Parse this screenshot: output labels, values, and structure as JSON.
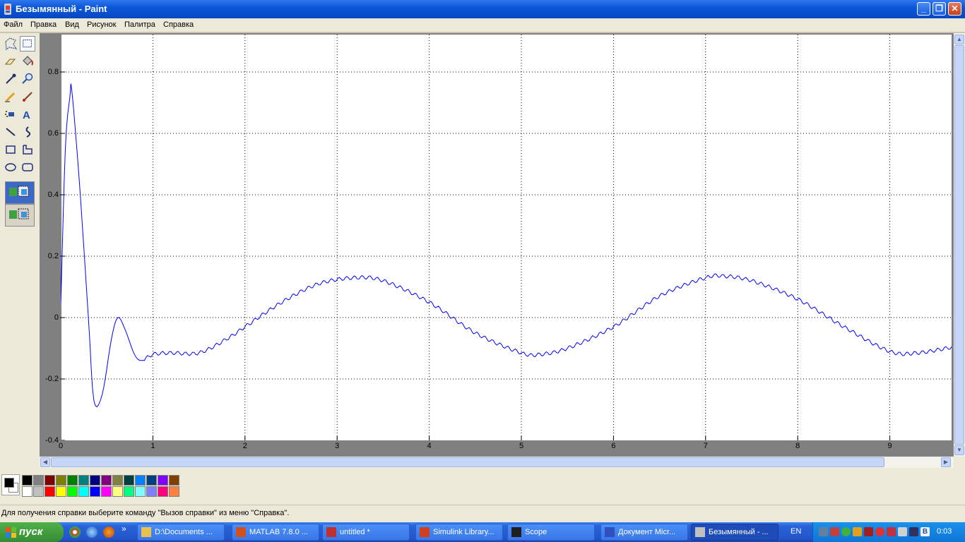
{
  "window": {
    "title": "Безымянный - Paint",
    "minimize": "_",
    "maximize": "❐",
    "close": "✕"
  },
  "menu": [
    "Файл",
    "Правка",
    "Вид",
    "Рисунок",
    "Палитра",
    "Справка"
  ],
  "tools": [
    {
      "name": "free-select-icon",
      "glyph": "✶"
    },
    {
      "name": "rect-select-icon",
      "glyph": "⬚"
    },
    {
      "name": "eraser-icon",
      "glyph": "▱"
    },
    {
      "name": "fill-bucket-icon",
      "glyph": "◈"
    },
    {
      "name": "color-picker-icon",
      "glyph": "⁄"
    },
    {
      "name": "magnifier-icon",
      "glyph": "⚲"
    },
    {
      "name": "pencil-icon",
      "glyph": "✎"
    },
    {
      "name": "brush-icon",
      "glyph": "∕"
    },
    {
      "name": "airbrush-icon",
      "glyph": "⁂"
    },
    {
      "name": "text-tool-icon",
      "glyph": "A"
    },
    {
      "name": "line-tool-icon",
      "glyph": "╲"
    },
    {
      "name": "curve-tool-icon",
      "glyph": "∫"
    },
    {
      "name": "rectangle-tool-icon",
      "glyph": "□"
    },
    {
      "name": "polygon-tool-icon",
      "glyph": "⌐"
    },
    {
      "name": "ellipse-tool-icon",
      "glyph": "⬭"
    },
    {
      "name": "rounded-rect-tool-icon",
      "glyph": "▢"
    }
  ],
  "selected_tool": "rect-select-icon",
  "chart_data": {
    "type": "line",
    "title": "",
    "xlabel": "",
    "ylabel": "",
    "xlim": [
      0,
      9.7
    ],
    "ylim": [
      -0.4,
      0.9
    ],
    "xticks": [
      0,
      1,
      2,
      3,
      4,
      5,
      6,
      7,
      8,
      9
    ],
    "yticks": [
      -0.4,
      -0.2,
      0,
      0.2,
      0.4,
      0.6,
      0.8
    ],
    "xtick_labels": [
      "0",
      "1",
      "2",
      "3",
      "4",
      "5",
      "6",
      "7",
      "8",
      "9"
    ],
    "ytick_labels": [
      "-0.4",
      "-0.2",
      "0",
      "0.2",
      "0.4",
      "0.6",
      "0.8"
    ],
    "grid": true,
    "line_color": "#0000ff",
    "series": [
      {
        "x": [
          0,
          0.05,
          0.1,
          0.12,
          0.2,
          0.3,
          0.36,
          0.45,
          0.55,
          0.62,
          0.7,
          0.8,
          0.88,
          1.0,
          1.2,
          1.5,
          1.8,
          2.0,
          2.4,
          2.8,
          3.2,
          3.5,
          4.0,
          4.5,
          5.0,
          5.2,
          5.5,
          6.0,
          6.5,
          7.0,
          7.2,
          7.5,
          8.0,
          8.5,
          9.0,
          9.3,
          9.7
        ],
        "y": [
          0.04,
          0.55,
          0.72,
          0.74,
          0.45,
          0.0,
          -0.27,
          -0.25,
          -0.07,
          0.0,
          -0.04,
          -0.12,
          -0.14,
          -0.12,
          -0.115,
          -0.115,
          -0.07,
          -0.03,
          0.05,
          0.11,
          0.13,
          0.12,
          0.05,
          -0.05,
          -0.115,
          -0.12,
          -0.1,
          -0.03,
          0.07,
          0.13,
          0.135,
          0.12,
          0.06,
          -0.03,
          -0.11,
          -0.115,
          -0.095
        ]
      }
    ]
  },
  "palette": {
    "foreground": "#000000",
    "background": "#ffffff",
    "colors_top": [
      "#000000",
      "#808080",
      "#800000",
      "#808000",
      "#008000",
      "#008080",
      "#000080",
      "#800080",
      "#808040",
      "#004040",
      "#0080ff",
      "#004080",
      "#8000ff",
      "#804000"
    ],
    "colors_bottom": [
      "#ffffff",
      "#c0c0c0",
      "#ff0000",
      "#ffff00",
      "#00ff00",
      "#00ffff",
      "#0000ff",
      "#ff00ff",
      "#ffff80",
      "#00ff80",
      "#80ffff",
      "#8080ff",
      "#ff0080",
      "#ff8040"
    ]
  },
  "status": {
    "text": "Для получения справки выберите команду \"Вызов справки\" из меню \"Справка\"."
  },
  "taskbar": {
    "start_label": "пуск",
    "tasks": [
      {
        "label": "D:\\Documents ...",
        "color": "#e8c050",
        "active": false
      },
      {
        "label": "MATLAB  7.8.0 ...",
        "color": "#d05020",
        "active": false
      },
      {
        "label": "untitled *",
        "color": "#c03030",
        "active": false
      },
      {
        "label": "Simulink Library...",
        "color": "#d04020",
        "active": false
      },
      {
        "label": "Scope",
        "color": "#202020",
        "active": false
      },
      {
        "label": "Документ Micr...",
        "color": "#3050c0",
        "active": false
      },
      {
        "label": "Безымянный - ...",
        "color": "#c0c0c0",
        "active": true
      }
    ],
    "language": "EN",
    "clock": "0:03"
  }
}
